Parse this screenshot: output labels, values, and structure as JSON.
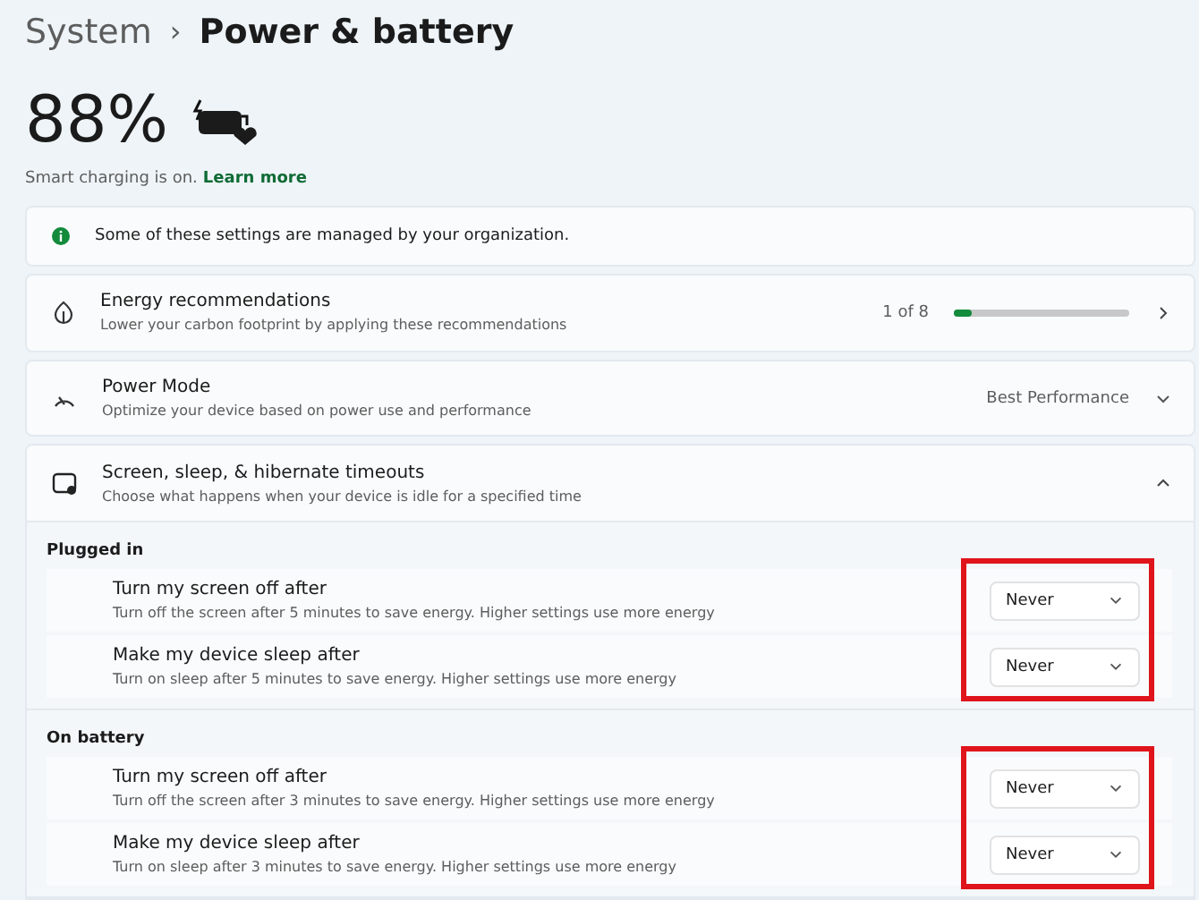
{
  "breadcrumb": {
    "parent": "System",
    "separator": "›",
    "current": "Power & battery"
  },
  "battery": {
    "percent": "88%",
    "smart_charging": "Smart charging is on.",
    "link": "Learn more"
  },
  "notice": {
    "text": "Some of these settings are managed by your organization."
  },
  "cards": [
    {
      "kind": "progress",
      "title": "Energy recommendations",
      "subtitle": "Lower your carbon footprint by applying these recommendations",
      "reading": "1 of 8",
      "level": 0.1
    },
    {
      "kind": "select",
      "title": "Power Mode",
      "subtitle": "Optimize your device based on power use and performance",
      "value": "Best Performance"
    },
    {
      "kind": "section",
      "title": "Screen, sleep, & hibernate timeouts",
      "subtitle": "Choose what happens when your device is idle for a specified time",
      "expanded": true
    }
  ],
  "groups": [
    {
      "heading": "Plugged in",
      "highlighted": true,
      "rows": [
        {
          "title": "Turn my screen off after",
          "subtitle": "Turn off the screen after 5 minutes to save energy. Higher settings use more energy",
          "value": "Never"
        },
        {
          "title": "Make my device sleep after",
          "subtitle": "Turn on sleep after 5 minutes to save energy. Higher settings use more energy",
          "value": "Never"
        }
      ]
    },
    {
      "heading": "On battery",
      "highlighted": true,
      "rows": [
        {
          "title": "Turn my screen off after",
          "subtitle": "Turn off the screen after 3 minutes to save energy. Higher settings use more energy",
          "value": "Never"
        },
        {
          "title": "Make my device sleep after",
          "subtitle": "Turn on sleep after 3 minutes to save energy. Higher settings use more energy",
          "value": "Never"
        }
      ]
    }
  ]
}
